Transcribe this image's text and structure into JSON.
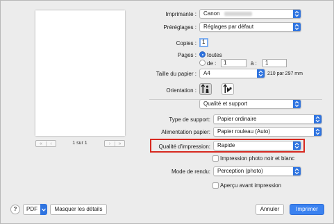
{
  "printer": {
    "label": "Imprimante :",
    "value": "Canon"
  },
  "presets": {
    "label": "Préréglages :",
    "value": "Réglages par défaut"
  },
  "copies": {
    "label": "Copies :",
    "value": "1"
  },
  "pages": {
    "label": "Pages :",
    "all_label": "toutes",
    "from_label": "de :",
    "from_value": "1",
    "to_label": "à :",
    "to_value": "1",
    "selected": "toutes"
  },
  "paper_size": {
    "label": "Taille du papier :",
    "value": "A4",
    "dimensions": "210 par 297 mm"
  },
  "orientation": {
    "label": "Orientation :",
    "selected": "portrait"
  },
  "section_menu": {
    "value": "Qualité et support"
  },
  "media_type": {
    "label": "Type de support:",
    "value": "Papier ordinaire"
  },
  "paper_source": {
    "label": "Alimentation papier:",
    "value": "Papier rouleau (Auto)"
  },
  "print_quality": {
    "label": "Qualité d'impression:",
    "value": "Rapide"
  },
  "grayscale": {
    "label": "Impression photo noir et blanc",
    "checked": false
  },
  "rendering": {
    "label": "Mode de rendu:",
    "value": "Perception (photo)"
  },
  "preview_checkbox": {
    "label": "Aperçu avant impression",
    "checked": false
  },
  "preview": {
    "page_counter": "1 sur 1",
    "first_icon": "double-chevron-left",
    "prev_icon": "chevron-left",
    "next_icon": "chevron-right",
    "last_icon": "double-chevron-right"
  },
  "footer": {
    "help_label": "?",
    "pdf_label": "PDF",
    "details_label": "Masquer les détails",
    "cancel_label": "Annuler",
    "print_label": "Imprimer"
  },
  "colors": {
    "accent": "#2f74e0",
    "highlight": "#d7281f",
    "default_button": "#3b82f0"
  }
}
